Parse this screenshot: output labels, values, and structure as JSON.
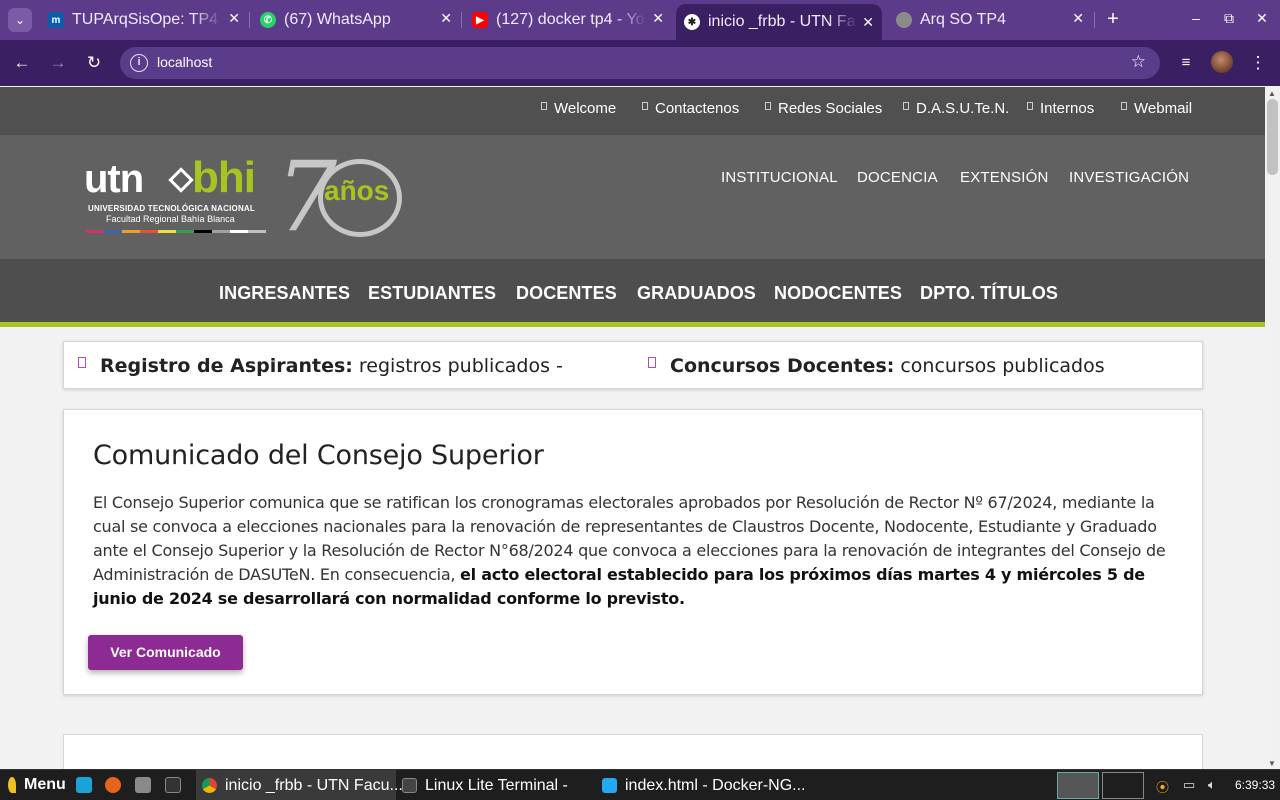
{
  "browser": {
    "tabs": [
      {
        "title": "TUPArqSisOpe: TP4",
        "favicon": "trello-icon",
        "color": "#0b5cad"
      },
      {
        "title": "(67) WhatsApp",
        "favicon": "whatsapp-icon",
        "color": "#25d366"
      },
      {
        "title": "(127) docker tp4 - Yo",
        "favicon": "youtube-icon",
        "color": "#ff0000"
      },
      {
        "title": "inicio _frbb - UTN Fa",
        "favicon": "utn-icon",
        "color": "#222222"
      },
      {
        "title": "Arq SO TP4",
        "favicon": "globe-icon",
        "color": "#8a8a8a"
      }
    ],
    "active_tab_index": 3,
    "address": "localhost"
  },
  "site": {
    "top_links": [
      "Welcome",
      "Contactenos",
      "Redes Sociales",
      "D.A.S.U.Te.N.",
      "Internos",
      "Webmail"
    ],
    "logo": {
      "utn": "utn",
      "bhi": "bhi",
      "line1": "UNIVERSIDAD TECNOLÓGICA NACIONAL",
      "line2": "Facultad Regional Bahía Blanca",
      "seven": "7",
      "anos": "años"
    },
    "main_nav": [
      "INSTITUCIONAL",
      "DOCENCIA",
      "EXTENSIÓN",
      "INVESTIGACIÓN"
    ],
    "categories": [
      "INGRESANTES",
      "ESTUDIANTES",
      "DOCENTES",
      "GRADUADOS",
      "NODOCENTES",
      "DPTO. TÍTULOS"
    ],
    "ticker": [
      {
        "label": "Registro de Aspirantes:",
        "text": "registros publicados -"
      },
      {
        "label": "Concursos Docentes:",
        "text": "concursos publicados"
      }
    ],
    "announcement": {
      "title": "Comunicado del Consejo Superior",
      "body_plain": "El Consejo Superior comunica que se ratifican los cronogramas electorales aprobados por Resolución de Rector Nº 67/2024, mediante la cual se convoca a elecciones nacionales para la renovación de representantes de Claustros Docente, Nodocente, Estudiante y Graduado ante el Consejo Superior y la Resolución de Rector N°68/2024 que convoca a elecciones para la renovación de integrantes del Consejo de Administración de DASUTeN. En consecuencia, ",
      "body_bold": "el acto electoral establecido para los próximos días martes 4 y miércoles 5 de junio de 2024 se desarrollará con normalidad conforme lo previsto.",
      "button": "Ver Comunicado"
    }
  },
  "taskbar": {
    "menu": "Menu",
    "tasks": [
      "inicio _frbb - UTN Facu...",
      "Linux Lite Terminal -",
      "index.html - Docker-NG..."
    ],
    "clock": "6:39:33"
  }
}
